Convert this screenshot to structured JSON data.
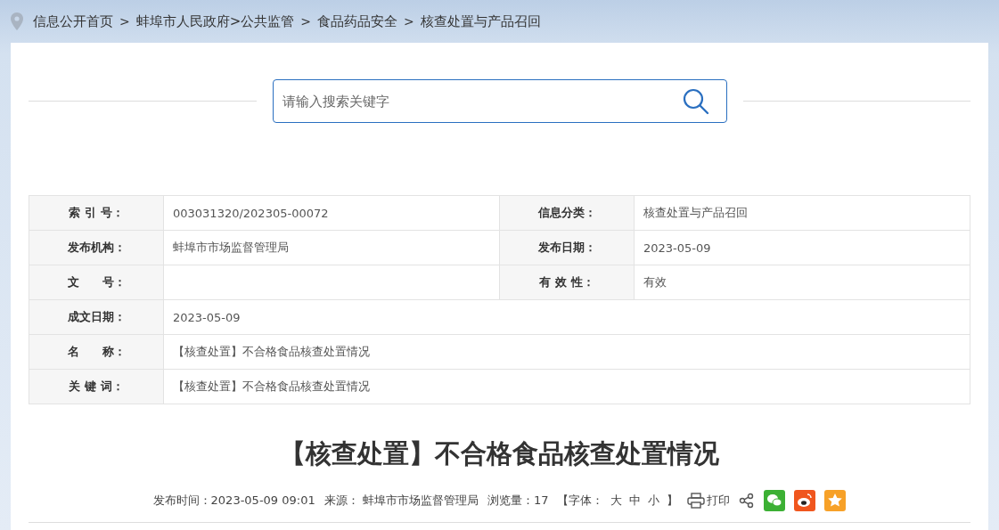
{
  "breadcrumb": [
    {
      "label": "信息公开首页"
    },
    {
      "separator": ">",
      "label": "蚌埠市人民政府>公共监管"
    },
    {
      "separator": ">",
      "label": "食品药品安全"
    },
    {
      "separator": ">",
      "label": "核查处置与产品召回"
    }
  ],
  "search": {
    "placeholder": "请输入搜索关键字"
  },
  "info_table": [
    {
      "fields": [
        {
          "label": "索 引 号：",
          "value": "003031320/202305-00072"
        },
        {
          "label": "信息分类：",
          "value": "核查处置与产品召回"
        }
      ]
    },
    {
      "fields": [
        {
          "label": "发布机构：",
          "value": "蚌埠市市场监督管理局"
        },
        {
          "label": "发布日期：",
          "value": "2023-05-09"
        }
      ]
    },
    {
      "fields": [
        {
          "label": "文　　号："
        },
        {
          "label": "有 效 性：",
          "value": "有效"
        }
      ]
    },
    {
      "fields": [
        {
          "label": "成文日期：",
          "value": "2023-05-09"
        }
      ]
    },
    {
      "fields": [
        {
          "label": "名　　称：",
          "value": "【核查处置】不合格食品核查处置情况"
        }
      ]
    },
    {
      "fields": [
        {
          "label": "关 键 词：",
          "value": "【核查处置】不合格食品核查处置情况"
        }
      ]
    }
  ],
  "article": {
    "title": "【核查处置】不合格食品核查处置情况",
    "meta": {
      "published": "发布时间：2023-05-09 09:01",
      "source": "来源： 蚌埠市市场监督管理局",
      "views": "浏览量：17",
      "font_open": "【字体：",
      "font_sizes": [
        "大",
        "中",
        "小"
      ],
      "font_close": "】",
      "print": "打印"
    }
  }
}
